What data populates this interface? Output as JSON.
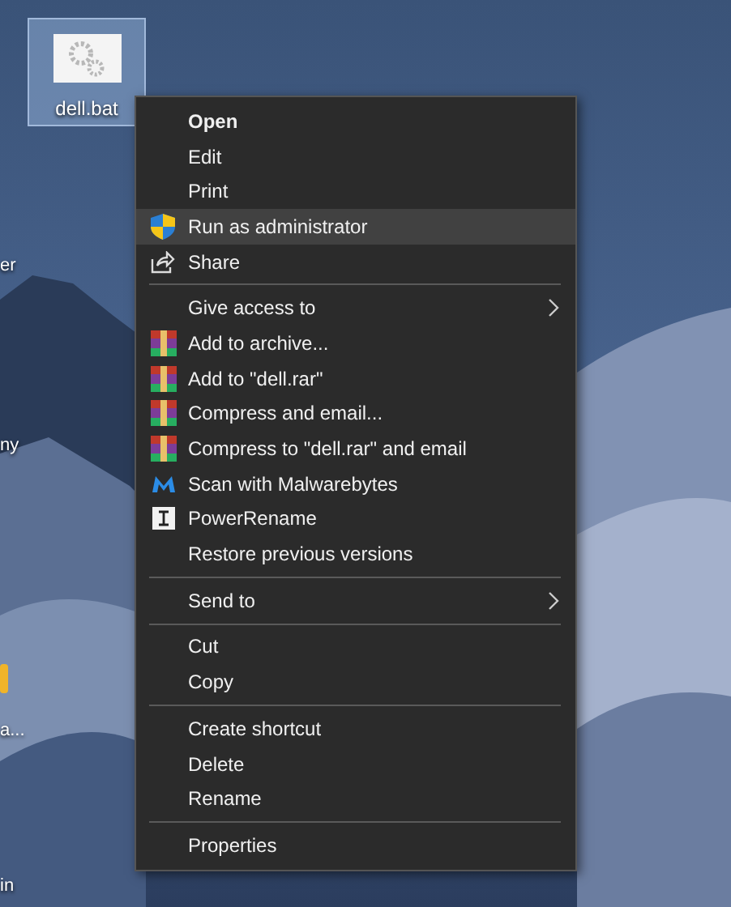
{
  "desktop": {
    "file_icon": {
      "label": "dell.bat",
      "selected": true
    },
    "edge_labels": [
      "er",
      "ny",
      "a...",
      "in"
    ]
  },
  "context_menu": {
    "groups": [
      [
        {
          "label": "Open",
          "kind": "plain",
          "bold": true,
          "highlighted": false,
          "submenu": false
        },
        {
          "label": "Edit",
          "kind": "plain",
          "bold": false,
          "highlighted": false,
          "submenu": false
        },
        {
          "label": "Print",
          "kind": "plain",
          "bold": false,
          "highlighted": false,
          "submenu": false
        },
        {
          "label": "Run as administrator",
          "kind": "admin",
          "bold": false,
          "highlighted": true,
          "submenu": false
        },
        {
          "label": "Share",
          "kind": "share",
          "bold": false,
          "highlighted": false,
          "submenu": false
        }
      ],
      [
        {
          "label": "Give access to",
          "kind": "plain",
          "bold": false,
          "highlighted": false,
          "submenu": true
        },
        {
          "label": "Add to archive...",
          "kind": "archive",
          "bold": false,
          "highlighted": false,
          "submenu": false
        },
        {
          "label": "Add to \"dell.rar\"",
          "kind": "archive",
          "bold": false,
          "highlighted": false,
          "submenu": false
        },
        {
          "label": "Compress and email...",
          "kind": "archive",
          "bold": false,
          "highlighted": false,
          "submenu": false
        },
        {
          "label": "Compress to \"dell.rar\" and email",
          "kind": "archive",
          "bold": false,
          "highlighted": false,
          "submenu": false
        },
        {
          "label": "Scan with Malwarebytes",
          "kind": "scan",
          "bold": false,
          "highlighted": false,
          "submenu": false
        },
        {
          "label": "PowerRename",
          "kind": "rename",
          "bold": false,
          "highlighted": false,
          "submenu": false
        },
        {
          "label": "Restore previous versions",
          "kind": "plain",
          "bold": false,
          "highlighted": false,
          "submenu": false
        }
      ],
      [
        {
          "label": "Send to",
          "kind": "plain",
          "bold": false,
          "highlighted": false,
          "submenu": true
        }
      ],
      [
        {
          "label": "Cut",
          "kind": "plain",
          "bold": false,
          "highlighted": false,
          "submenu": false
        },
        {
          "label": "Copy",
          "kind": "plain",
          "bold": false,
          "highlighted": false,
          "submenu": false
        }
      ],
      [
        {
          "label": "Create shortcut",
          "kind": "plain",
          "bold": false,
          "highlighted": false,
          "submenu": false
        },
        {
          "label": "Delete",
          "kind": "plain",
          "bold": false,
          "highlighted": false,
          "submenu": false
        },
        {
          "label": "Rename",
          "kind": "plain",
          "bold": false,
          "highlighted": false,
          "submenu": false
        }
      ],
      [
        {
          "label": "Properties",
          "kind": "plain",
          "bold": false,
          "highlighted": false,
          "submenu": false
        }
      ]
    ]
  }
}
